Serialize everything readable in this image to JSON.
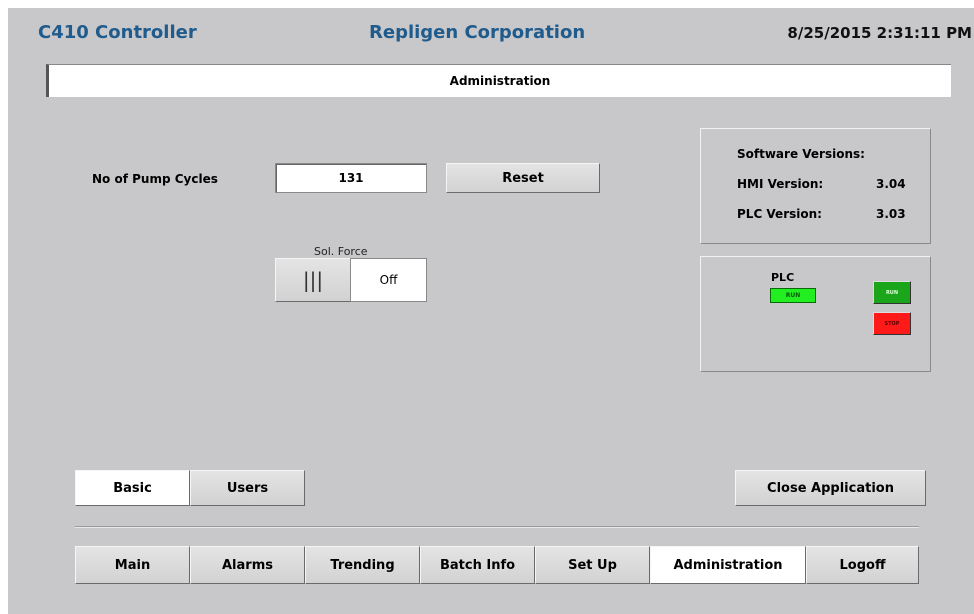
{
  "header": {
    "app_title": "C410 Controller",
    "company": "Repligen Corporation",
    "datetime": "8/25/2015 2:31:11 PM"
  },
  "page_title": "Administration",
  "pump": {
    "label": "No of Pump Cycles",
    "value": "131",
    "reset_label": "Reset"
  },
  "sol_force": {
    "label": "Sol. Force",
    "toggle_glyph": "|||",
    "state": "Off"
  },
  "versions": {
    "title": "Software Versions:",
    "hmi_label": "HMI Version:",
    "hmi_value": "3.04",
    "plc_label": "PLC Version:",
    "plc_value": "3.03"
  },
  "plc": {
    "label": "PLC",
    "status": "RUN",
    "run_button": "RUN",
    "stop_button": "STOP",
    "colors": {
      "run": "#1aa51a",
      "stop": "#ff1a1a",
      "status": "#22ee22"
    }
  },
  "sub_tabs": [
    {
      "label": "Basic",
      "active": true
    },
    {
      "label": "Users",
      "active": false
    }
  ],
  "close_app_label": "Close Application",
  "nav": [
    {
      "label": "Main"
    },
    {
      "label": "Alarms"
    },
    {
      "label": "Trending"
    },
    {
      "label": "Batch Info"
    },
    {
      "label": "Set Up"
    },
    {
      "label": "Administration",
      "active": true
    },
    {
      "label": "Logoff"
    }
  ]
}
